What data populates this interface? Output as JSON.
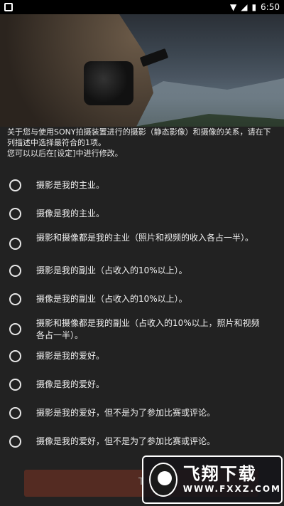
{
  "status": {
    "time": "6:50"
  },
  "intro": {
    "line1": "关于您与使用SONY拍摄装置进行的摄影（静态影像）和摄像的关系，请在下列描述中选择最符合的1项。",
    "line2": "您可以以后在[设定]中进行修改。"
  },
  "options": [
    "摄影是我的主业。",
    "摄像是我的主业。",
    "摄影和摄像都是我的主业（照片和视频的收入各占一半）。",
    "摄影是我的副业（占收入的10%以上）。",
    "摄像是我的副业（占收入的10%以上）。",
    "摄影和摄像都是我的副业（占收入的10%以上，照片和视频各占一半）。",
    "摄影是我的爱好。",
    "摄像是我的爱好。",
    "摄影是我的爱好，但不是为了参加比赛或评论。",
    "摄像是我的爱好，但不是为了参加比赛或评论。"
  ],
  "button": {
    "label": "T"
  },
  "watermark": {
    "name": "飞翔下载",
    "url": "WWW.FXXZ.COM"
  }
}
